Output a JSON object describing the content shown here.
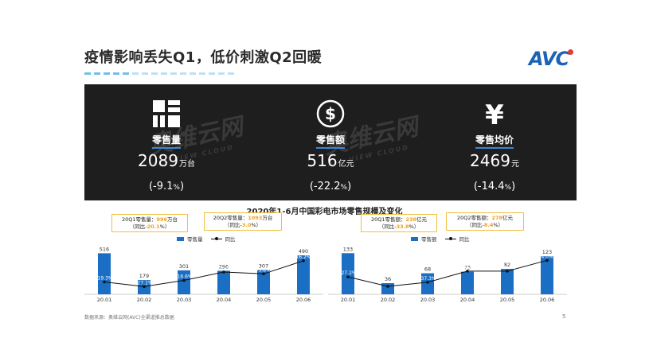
{
  "header": {
    "title": "疫情影响丢失Q1，低价刺激Q2回暖",
    "logo_text": "AVC"
  },
  "kpis": [
    {
      "icon": "grid-icon",
      "label": "零售量",
      "value": "2089",
      "unit": "万台",
      "change": "-9.1",
      "pct": "%"
    },
    {
      "icon": "dollar-coin-icon",
      "label": "零售额",
      "value": "516",
      "unit": "亿元",
      "change": "-22.2",
      "pct": "%"
    },
    {
      "icon": "yen-icon",
      "label": "零售均价",
      "value": "2469",
      "unit": "元",
      "change": "-14.4",
      "pct": "%"
    }
  ],
  "watermark": {
    "cn": "奥维云网",
    "en": "ALL VIEW CLOUD"
  },
  "chart_title": "2020年1-6月中国彩电市场零售规模及变化",
  "callouts": {
    "left_q1": {
      "pre": "20Q1零售量：",
      "hl": "996",
      "post": "万台",
      "yoy_pre": "（同比-",
      "yoy_hl": "20.1",
      "yoy_post": "%）"
    },
    "left_q2": {
      "pre": "20Q2零售量：",
      "hl": "1093",
      "post": "万台",
      "yoy_pre": "（同比-",
      "yoy_hl": "3.0",
      "yoy_post": "%）"
    },
    "right_q1": {
      "pre": "20Q1零售额：",
      "hl": "238",
      "post": "亿元",
      "yoy_pre": "（同比-",
      "yoy_hl": "33.8",
      "yoy_post": "%）"
    },
    "right_q2": {
      "pre": "20Q2零售额：",
      "hl": "278",
      "post": "亿元",
      "yoy_pre": "（同比-",
      "yoy_hl": "8.4",
      "yoy_post": "%）"
    }
  },
  "legend": {
    "left_bar": "零售量",
    "left_line": "同比",
    "right_bar": "零售额",
    "right_line": "同比"
  },
  "chart_data": [
    {
      "type": "bar",
      "categories": [
        "20.01",
        "20.02",
        "20.03",
        "20.04",
        "20.05",
        "20.06"
      ],
      "series": [
        {
          "name": "零售量",
          "values": [
            516,
            179,
            301,
            296,
            307,
            490
          ]
        },
        {
          "name": "同比",
          "type": "line",
          "values": [
            -19.3,
            -27.1,
            -16.6,
            -2.7,
            -5.8,
            16.2
          ],
          "labels": [
            "-19.3%",
            "-27.1%",
            "-16.6%",
            "-2.7%",
            "-5.8%",
            "16.2%"
          ]
        }
      ],
      "bar_ylim": [
        0,
        700
      ],
      "line_ylim": [
        -40,
        40
      ]
    },
    {
      "type": "bar",
      "categories": [
        "20.01",
        "20.02",
        "20.03",
        "20.04",
        "20.05",
        "20.06"
      ],
      "series": [
        {
          "name": "零售额",
          "values": [
            133,
            36,
            68,
            73,
            82,
            123
          ]
        },
        {
          "name": "同比",
          "type": "line",
          "values": [
            -27.2,
            -45.0,
            -37.3,
            -16.3,
            -16.4,
            4.0
          ],
          "labels": [
            "-27.2%",
            "",
            "-37.3%",
            "-16.3%",
            "-16.4%",
            "4.0%"
          ]
        }
      ],
      "bar_ylim": [
        0,
        180
      ],
      "line_ylim": [
        -60,
        30
      ]
    }
  ],
  "footer": {
    "source": "数据来源：奥维云网(AVC)全渠道推总数据",
    "page": "5"
  }
}
